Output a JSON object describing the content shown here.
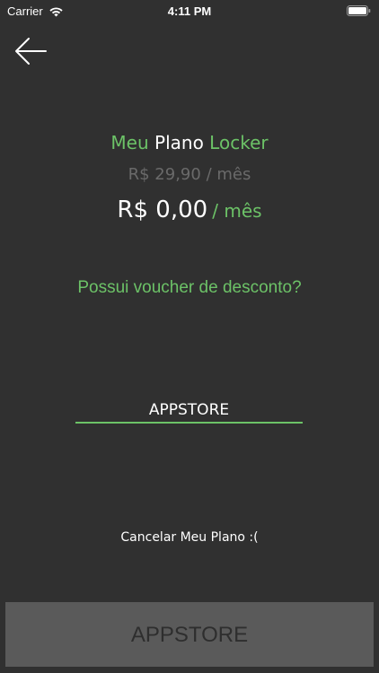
{
  "status_bar": {
    "carrier": "Carrier",
    "time": "4:11 PM",
    "wifi_icon": "wifi-icon",
    "battery_icon": "battery-icon"
  },
  "nav": {
    "back_icon": "arrow-left-icon"
  },
  "plan": {
    "title_word1": "Meu",
    "title_word2": "Plano",
    "title_word3": "Locker",
    "old_price_amount": "R$ 29,90",
    "old_price_period": "/ mês",
    "new_price_amount": "R$ 0,00",
    "new_price_period": "/ mês"
  },
  "voucher": {
    "question": "Possui voucher de desconto?",
    "value": "APPSTORE"
  },
  "cancel": {
    "label": "Cancelar Meu Plano :("
  },
  "bottom_button": {
    "label": "APPSTORE"
  },
  "colors": {
    "background": "#303030",
    "accent_green": "#6cc267",
    "muted_gray": "#6a6a6a",
    "button_bg": "#5a5a5a"
  }
}
